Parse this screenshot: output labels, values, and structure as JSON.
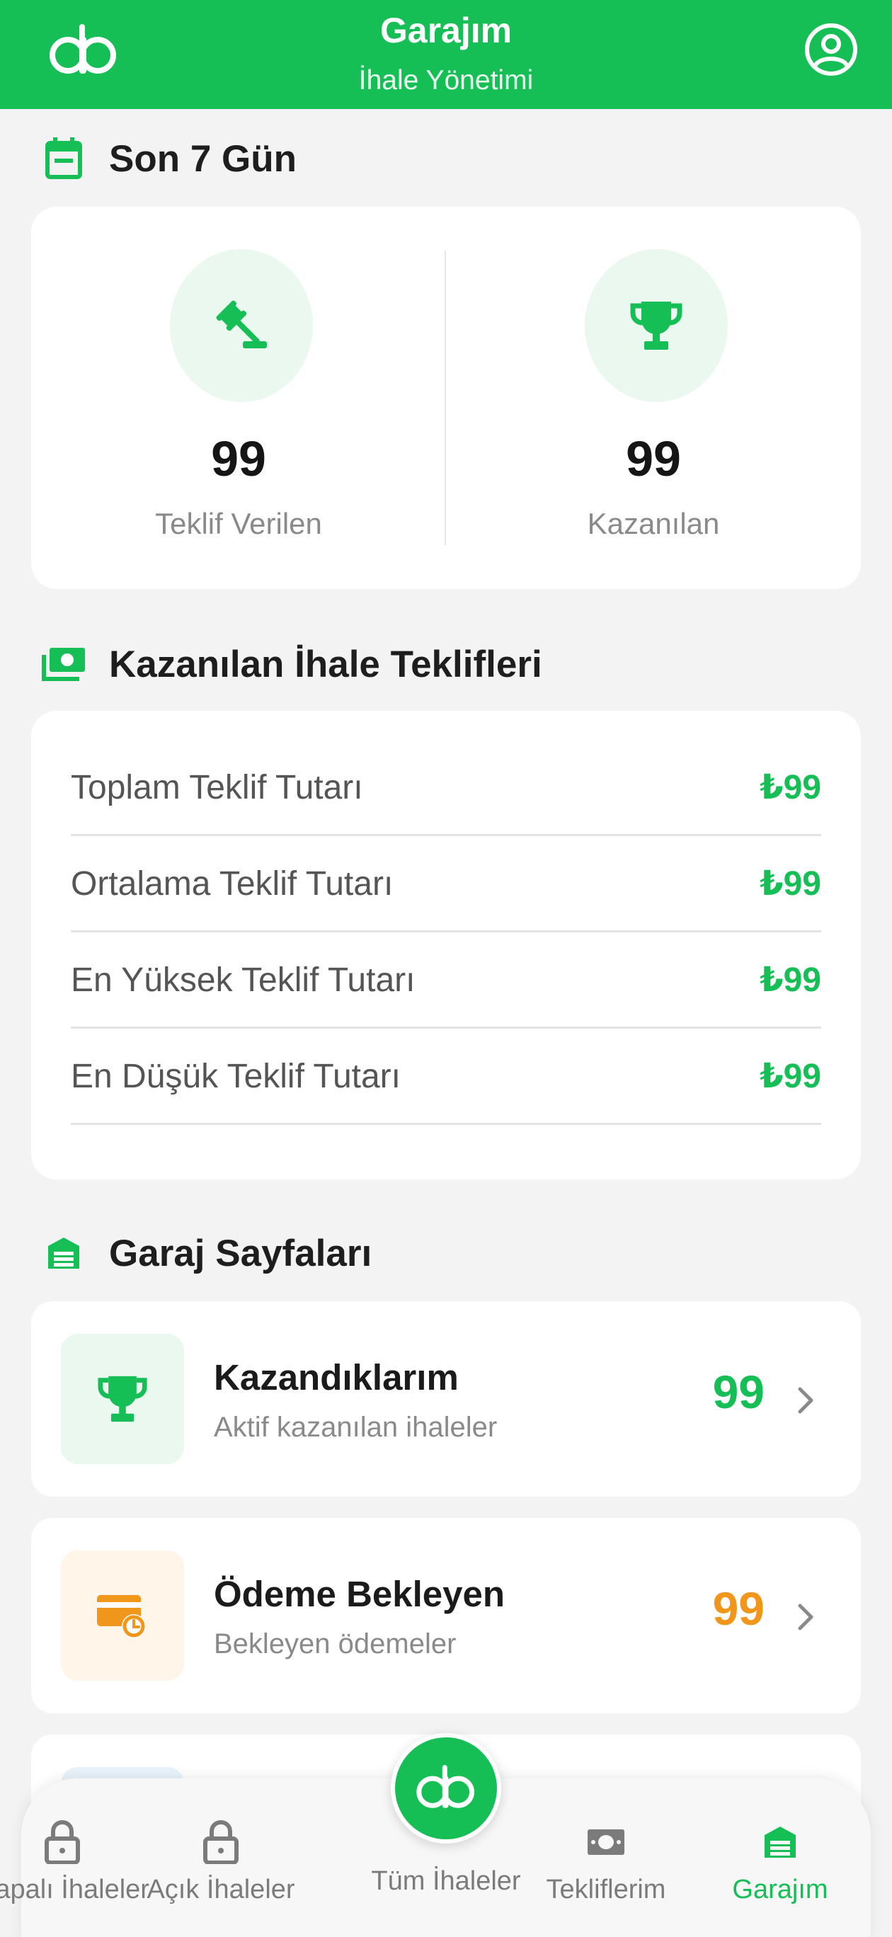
{
  "header": {
    "title": "Garajım",
    "subtitle": "İhale Yönetimi",
    "logo_icon": "ab-logo",
    "profile_icon": "user-circle-icon"
  },
  "last7days": {
    "heading": "Son 7 Gün",
    "stats": [
      {
        "icon": "gavel-icon",
        "value": "99",
        "label": "Teklif Verilen"
      },
      {
        "icon": "trophy-icon",
        "value": "99",
        "label": "Kazanılan"
      }
    ]
  },
  "won_bids": {
    "heading": "Kazanılan İhale Teklifleri",
    "rows": [
      {
        "label": "Toplam Teklif Tutarı",
        "value": "₺99"
      },
      {
        "label": "Ortalama Teklif Tutarı",
        "value": "₺99"
      },
      {
        "label": "En Yüksek Teklif Tutarı",
        "value": "₺99"
      },
      {
        "label": "En Düşük Teklif Tutarı",
        "value": "₺99"
      }
    ]
  },
  "garage_pages": {
    "heading": "Garaj Sayfaları",
    "items": [
      {
        "title": "Kazandıklarım",
        "subtitle": "Aktif kazanılan ihaleler",
        "count": "99",
        "icon": "trophy-icon",
        "color": "#16bf55",
        "bg": "#eaf8ef"
      },
      {
        "title": "Ödeme Bekleyen",
        "subtitle": "Bekleyen ödemeler",
        "count": "99",
        "icon": "payment-clock-icon",
        "color": "#f0961b",
        "bg": "#fff5e8"
      }
    ]
  },
  "bottom_nav": {
    "items": [
      {
        "label": "Kapalı İhaleler",
        "icon": "lock-icon"
      },
      {
        "label": "Açık İhaleler",
        "icon": "lock-icon"
      },
      {
        "label": "Tüm İhaleler",
        "icon": "ab-logo"
      },
      {
        "label": "Tekliflerim",
        "icon": "money-icon"
      },
      {
        "label": "Garajım",
        "icon": "garage-icon"
      }
    ],
    "active": "Garajım"
  },
  "colors": {
    "primary": "#16bf55",
    "warning": "#f0961b",
    "background": "#f3f3f3"
  }
}
